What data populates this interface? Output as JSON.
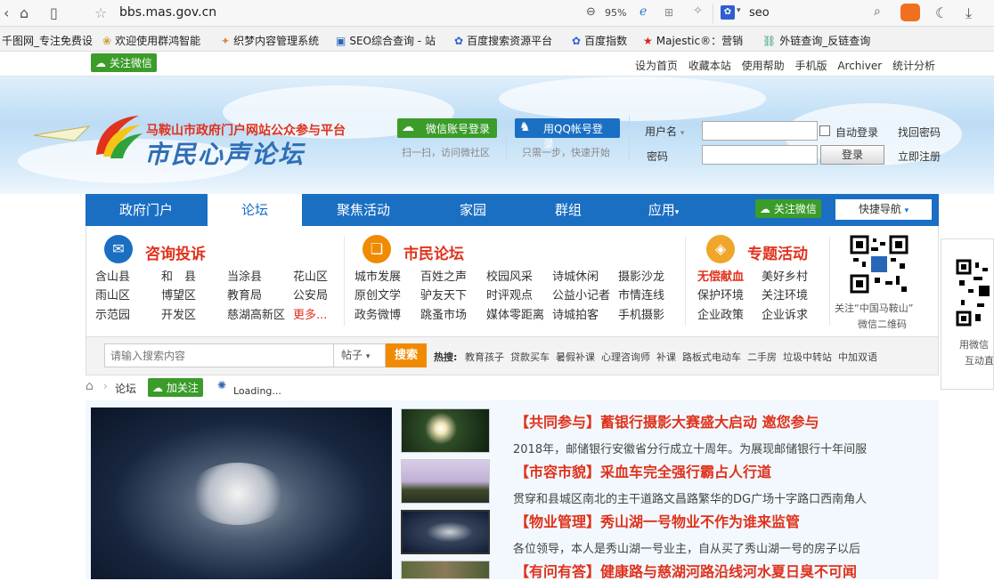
{
  "browser": {
    "url": "bbs.mas.gov.cn",
    "zoom": "95%",
    "search_text": "seo"
  },
  "bookmarks": [
    {
      "label": "千图网_专注免费设",
      "icon": "thumb"
    },
    {
      "label": "欢迎使用群鸿智能",
      "icon": "lotus"
    },
    {
      "label": "织梦内容管理系统",
      "icon": "pinwheel"
    },
    {
      "label": "SEO综合查询 - 站",
      "icon": "doc"
    },
    {
      "label": "百度搜索资源平台",
      "icon": "paw"
    },
    {
      "label": "百度指数",
      "icon": "paw"
    },
    {
      "label": "Majestic®：营销",
      "icon": "star"
    },
    {
      "label": "外链查询_反链查询",
      "icon": "chain"
    }
  ],
  "util": {
    "wechat_follow": "关注微信",
    "links": [
      "设为首页",
      "收藏本站",
      "使用帮助",
      "手机版",
      "Archiver",
      "统计分析"
    ]
  },
  "header": {
    "subtitle": "马鞍山市政府门户网站公众参与平台",
    "title": "市民心声论坛",
    "wechat_login": "微信账号登录",
    "wechat_login_sub": "扫一扫，访问微社区",
    "qq_login": "用QQ帐号登录",
    "qq_login_sub": "只需一步，快速开始",
    "username_label": "用户名",
    "password_label": "密码",
    "auto_login": "自动登录",
    "login_button": "登录",
    "forgot_password": "找回密码",
    "register": "立即注册"
  },
  "nav": {
    "items": [
      "政府门户",
      "论坛",
      "聚焦活动",
      "家园",
      "群组",
      "应用"
    ],
    "wechat": "关注微信",
    "quick_nav": "快捷导航"
  },
  "panels": {
    "complaint": {
      "title": "咨询投诉",
      "items": [
        "含山县",
        "和　县",
        "当涂县",
        "花山区",
        "雨山区",
        "博望区",
        "教育局",
        "公安局",
        "示范园",
        "开发区",
        "慈湖高新区",
        "更多..."
      ]
    },
    "forum": {
      "title": "市民论坛",
      "items": [
        "城市发展",
        "百姓之声",
        "校园风采",
        "诗城休闲",
        "摄影沙龙",
        "原创文学",
        "驴友天下",
        "时评观点",
        "公益小记者",
        "市情连线",
        "政务微博",
        "跳蚤市场",
        "媒体零距离",
        "诗城拍客",
        "手机摄影"
      ]
    },
    "activity": {
      "title": "专题活动",
      "items": [
        "无偿献血",
        "美好乡村",
        "保护环境",
        "关注环境",
        "企业政策",
        "企业诉求"
      ]
    },
    "qr_caption1": "关注“中国马鞍山”",
    "qr_caption2": "微信二维码"
  },
  "search": {
    "placeholder": "请输入搜索内容",
    "type": "帖子",
    "button": "搜索",
    "hot_label": "热搜:",
    "hot_items": [
      "教育孩子",
      "贷款买车",
      "暑假补课",
      "心理咨询师",
      "补课",
      "路板式电动车",
      "二手房",
      "垃圾中转站",
      "中加双语"
    ]
  },
  "breadcrumb": {
    "current": "论坛",
    "follow": "加关注",
    "loading": "Loading..."
  },
  "news": [
    {
      "title": "【共同参与】蓄银行摄影大赛盛大启动 邀您参与",
      "desc": "2018年，邮储银行安徽省分行成立十周年。为展现邮储银行十年间服"
    },
    {
      "title": "【市容市貌】采血车完全强行霸占人行道",
      "desc": "贯穿和县城区南北的主干道路文昌路繁华的DG广场十字路口西南角人"
    },
    {
      "title": "【物业管理】秀山湖一号物业不作为谁来监管",
      "desc": "各位领导，本人是秀山湖一号业主，自从买了秀山湖一号的房子以后"
    },
    {
      "title": "【有问有答】健康路与慈湖河路沿线河水夏日臭不可闻",
      "desc": ""
    }
  ],
  "side": {
    "caption1": "用微信",
    "caption2": "互动直"
  },
  "colors": {
    "nav_blue": "#1a6fc3",
    "accent_red": "#e0321c",
    "wechat_green": "#3b9c2a",
    "search_orange": "#f08a00"
  }
}
